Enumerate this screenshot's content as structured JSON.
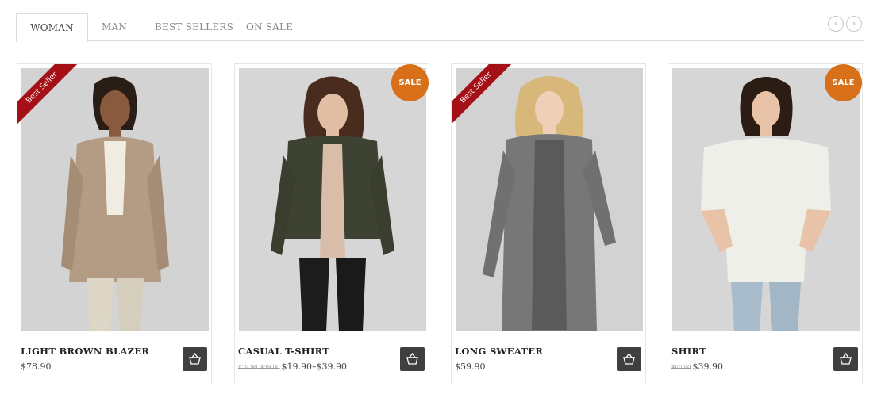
{
  "tabs": [
    {
      "label": "WOMAN",
      "active": true
    },
    {
      "label": "MAN"
    },
    {
      "label": "BEST SELLERS"
    },
    {
      "label": "ON SALE"
    }
  ],
  "nav": {
    "prev_icon": "‹",
    "next_icon": "›"
  },
  "products": [
    {
      "name": "LIGHT BROWN BLAZER",
      "price": "$78.90",
      "old_price": "",
      "badge": "Best Seller",
      "badge_type": "ribbon"
    },
    {
      "name": "CASUAL T-SHIRT",
      "price": "$19.90–$39.90",
      "old_price": "$29.90–$39.90",
      "badge": "SALE",
      "badge_type": "circle"
    },
    {
      "name": "LONG SWEATER",
      "price": "$59.90",
      "old_price": "",
      "badge": "Best Seller",
      "badge_type": "ribbon"
    },
    {
      "name": "SHIRT",
      "price": "$39.90",
      "old_price": "$60.90",
      "badge": "SALE",
      "badge_type": "circle"
    }
  ],
  "colors": {
    "ribbon": "#a50f16",
    "sale_badge": "#d8701a",
    "cart_button": "#3f3f3f"
  },
  "icons": {
    "cart": "basket-icon"
  }
}
